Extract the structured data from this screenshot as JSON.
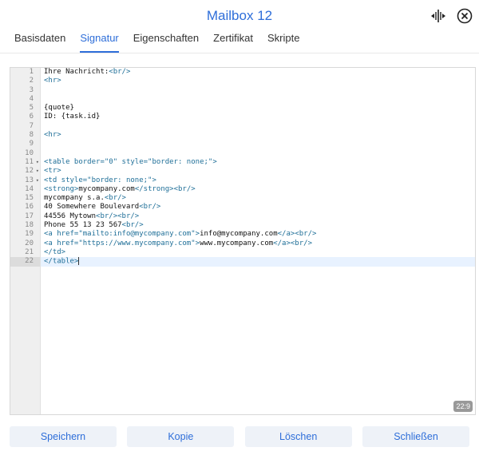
{
  "dialog": {
    "title": "Mailbox 12"
  },
  "tabs": [
    {
      "label": "Basisdaten",
      "active": false
    },
    {
      "label": "Signatur",
      "active": true
    },
    {
      "label": "Eigenschaften",
      "active": false
    },
    {
      "label": "Zertifikat",
      "active": false
    },
    {
      "label": "Skripte",
      "active": false
    }
  ],
  "editor": {
    "lines": [
      "Ihre Nachricht:<br/>",
      "<hr>",
      "",
      "",
      "{quote}",
      "ID: {task.id}",
      "",
      "<hr>",
      "",
      "",
      "<table border=\"0\" style=\"border: none;\">",
      "<tr>",
      "<td style=\"border: none;\">",
      "<strong>mycompany.com</strong><br/>",
      "mycompany s.a.<br/>",
      "40 Somewhere Boulevard<br/>",
      "44556 Mytown<br/><br/>",
      "Phone 55 13 23 567<br/>",
      "<a href=\"mailto:info@mycompany.com\">info@mycompany.com</a><br/>",
      "<a href=\"https://www.mycompany.com\">www.mycompany.com</a><br/>",
      "</td>",
      "</table>"
    ],
    "fold_lines": [
      11,
      12,
      13
    ],
    "current_line": 22,
    "cursor_position": "22:9"
  },
  "buttons": {
    "save": "Speichern",
    "copy": "Kopie",
    "delete": "Löschen",
    "close": "Schließen"
  },
  "colors": {
    "accent": "#2e6ed9",
    "tag": "#1f6f98"
  },
  "icons": {
    "resize": "column-resize-icon",
    "close": "close-circle-icon"
  }
}
